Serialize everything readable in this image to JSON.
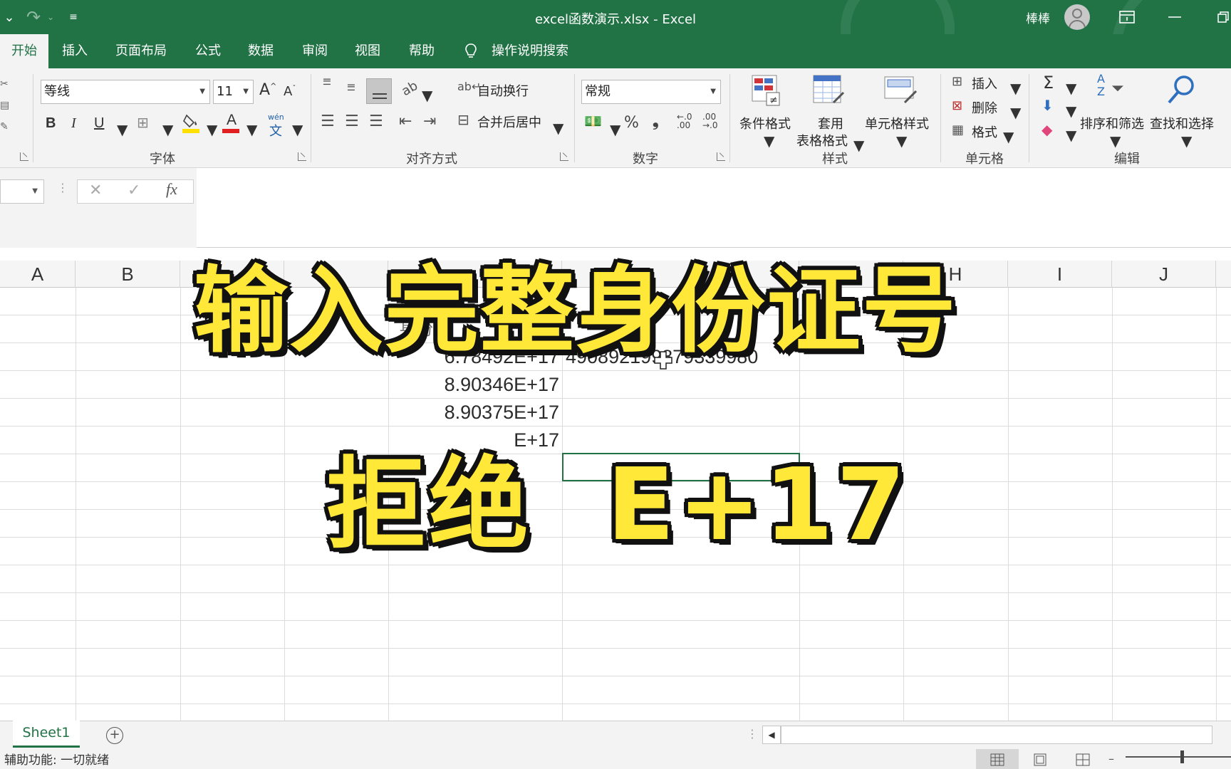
{
  "window": {
    "title": "excel函数演示.xlsx  -  Excel",
    "user": "棒棒"
  },
  "quick_access": {
    "undo_icon": "undo-icon",
    "redo_icon": "redo-icon",
    "customize_icon": "customize-quick-access-icon"
  },
  "tabs": [
    {
      "label": "开始"
    },
    {
      "label": "插入"
    },
    {
      "label": "页面布局"
    },
    {
      "label": "公式"
    },
    {
      "label": "数据"
    },
    {
      "label": "审阅"
    },
    {
      "label": "视图"
    },
    {
      "label": "帮助"
    }
  ],
  "tell_me": "操作说明搜索",
  "ribbon": {
    "font": {
      "name": "等线",
      "size": "11",
      "group_label": "字体",
      "phonetic": "wén"
    },
    "alignment": {
      "wrap_text": "自动换行",
      "merge_center": "合并后居中",
      "group_label": "对齐方式"
    },
    "number": {
      "format": "常规",
      "group_label": "数字"
    },
    "styles": {
      "conditional": "条件格式",
      "table_line1": "套用",
      "table_line2": "表格格式",
      "cell_styles": "单元格样式",
      "group_label": "样式"
    },
    "cells": {
      "insert": "插入",
      "delete": "删除",
      "format": "格式",
      "group_label": "单元格"
    },
    "editing": {
      "sort_filter": "排序和筛选",
      "find_select": "查找和选择",
      "group_label": "编辑"
    }
  },
  "formula_bar": {
    "name_box": "",
    "formula": ""
  },
  "columns": [
    "A",
    "B",
    "H",
    "I",
    "J"
  ],
  "cells": {
    "d1_partial": "身份",
    "d2": "6.78492E+17",
    "e2": "490892199879339980",
    "d3": "8.90346E+17",
    "d4": "8.90375E+17",
    "d5": "E+17"
  },
  "overlay": {
    "headline": "输入完整身份证号",
    "subline": "拒绝  E+17"
  },
  "sheets": [
    {
      "name": "Sheet1"
    }
  ],
  "status": "辅助功能: 一切就绪",
  "colors": {
    "excel_green": "#217346",
    "overlay_yellow": "#ffe838",
    "overlay_outline": "#111111"
  }
}
